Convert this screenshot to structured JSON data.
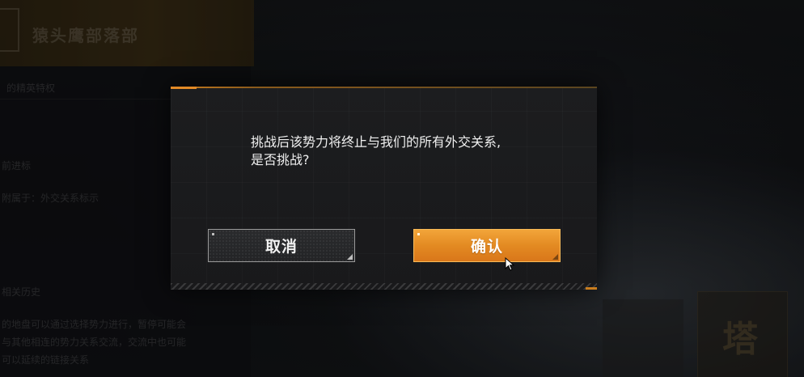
{
  "background": {
    "header_title": "猿头鹰部落部",
    "lines": [
      "的精英特权",
      "前进标",
      "附属于：外交关系标示",
      "相关历史",
      "的地盘可以通过选择势力进行，暂停可能会",
      "与其他相连的势力关系交流，交流中也可能",
      "可以延续的链接关系"
    ],
    "card_glyph": "塔"
  },
  "dialog": {
    "message_line1": "挑战后该势力将终止与我们的所有外交关系,",
    "message_line2": "是否挑战?",
    "cancel_label": "取消",
    "confirm_label": "确认"
  },
  "colors": {
    "accent_orange": "#e38a22",
    "dialog_bg": "#1c1d1f",
    "text_light": "#f0f0f0"
  }
}
